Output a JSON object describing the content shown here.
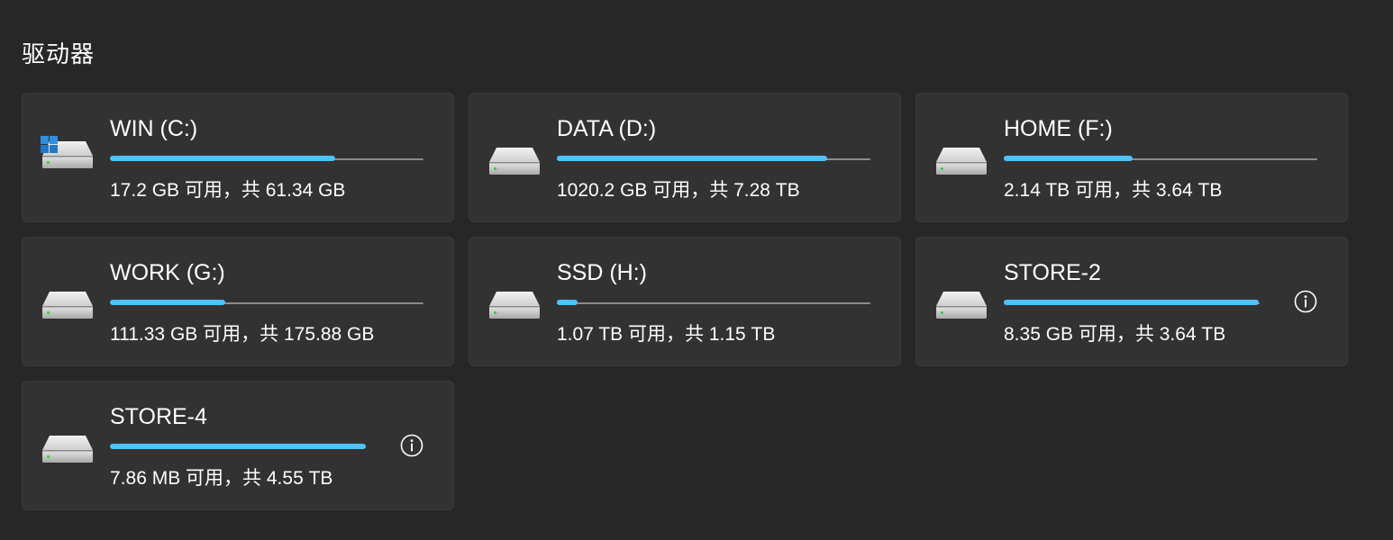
{
  "section": {
    "title": "驱动器"
  },
  "drives": [
    {
      "name": "WIN (C:)",
      "stats": "17.2 GB 可用，共 61.34 GB",
      "used_fraction": 0.719,
      "system": true,
      "warning": false
    },
    {
      "name": "DATA (D:)",
      "stats": "1020.2 GB 可用，共 7.28 TB",
      "used_fraction": 0.863,
      "system": false,
      "warning": false
    },
    {
      "name": "HOME (F:)",
      "stats": "2.14 TB 可用，共 3.64 TB",
      "used_fraction": 0.412,
      "system": false,
      "warning": false
    },
    {
      "name": "WORK (G:)",
      "stats": "111.33 GB 可用，共 175.88 GB",
      "used_fraction": 0.367,
      "system": false,
      "warning": false
    },
    {
      "name": "SSD (H:)",
      "stats": "1.07 TB 可用，共 1.15 TB",
      "used_fraction": 0.065,
      "system": false,
      "warning": false
    },
    {
      "name": "STORE-2",
      "stats": "8.35 GB 可用，共 3.64 TB",
      "used_fraction": 0.998,
      "system": false,
      "warning": true
    },
    {
      "name": "STORE-4",
      "stats": "7.86 MB 可用，共 4.55 TB",
      "used_fraction": 0.999,
      "system": false,
      "warning": true
    }
  ],
  "icons": {
    "drive": "hard-drive-icon",
    "system": "windows-logo-icon",
    "warning": "info-icon"
  },
  "colors": {
    "background": "#272727",
    "card": "#323232",
    "accent": "#4cc2ff",
    "track": "#8c8c8c",
    "led": "#3ad23a"
  }
}
